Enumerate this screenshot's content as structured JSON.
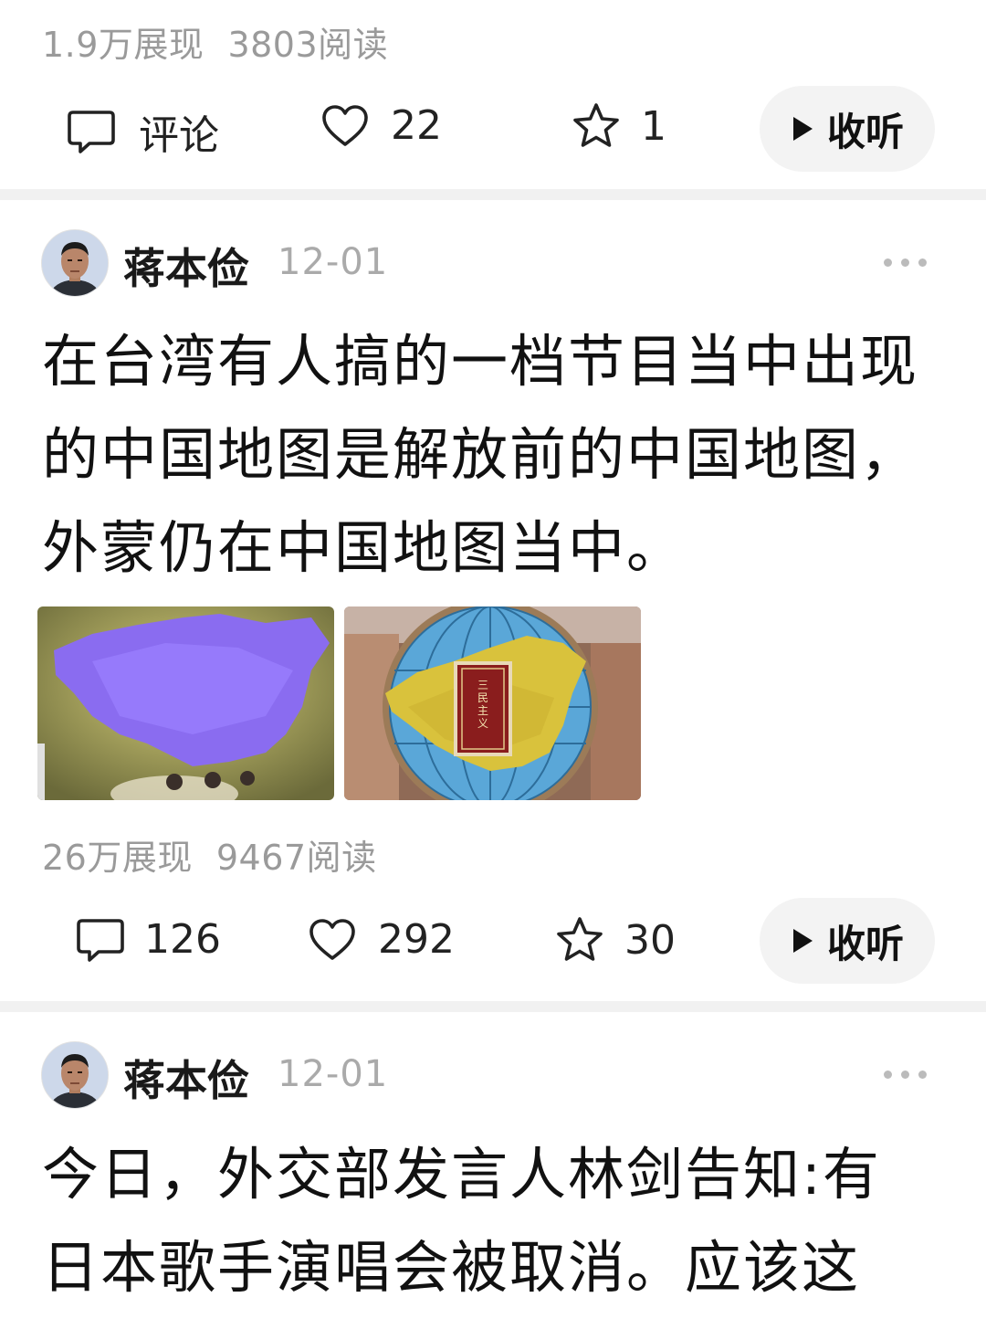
{
  "post1": {
    "stats": {
      "impressions": "1.9万展现",
      "reads": "3803阅读"
    },
    "actions": {
      "comment": "评论",
      "like": "22",
      "favorite": "1",
      "listen": "收听"
    }
  },
  "post2": {
    "author": "蒋本俭",
    "date": "12-01",
    "text_lines": [
      "在台湾有人搞的一档节目当中出现",
      "的中国地图是解放前的中国地图，",
      "外蒙仍在中国地图当中。"
    ],
    "images": [
      {
        "description_icon": "purple-china-map-image"
      },
      {
        "description_icon": "globe-china-map-image",
        "book_title": "三民主义"
      }
    ],
    "stats": {
      "impressions": "26万展现",
      "reads": "9467阅读"
    },
    "actions": {
      "comment": "126",
      "like": "292",
      "favorite": "30",
      "listen": "收听"
    }
  },
  "post3": {
    "author": "蒋本俭",
    "date": "12-01",
    "text_lines": [
      "今日，外交部发言人林剑告知:有",
      "日本歌手演唱会被取消。应该这"
    ]
  },
  "colors": {
    "muted": "#9a9a9a",
    "separator": "#f1f1f1",
    "pill": "#f3f3f3"
  }
}
